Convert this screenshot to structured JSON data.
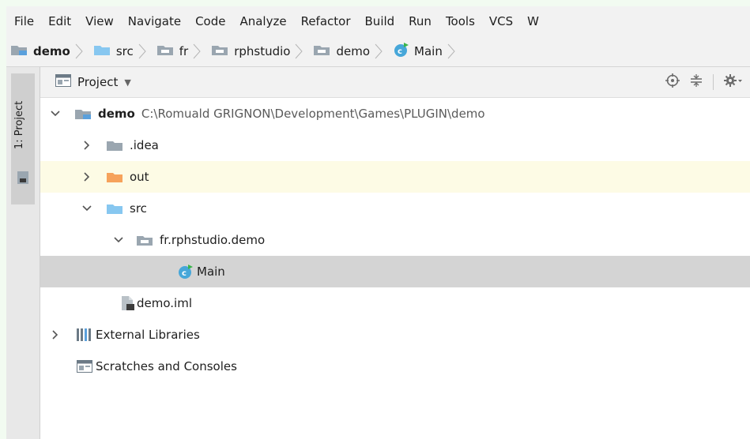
{
  "menu": [
    "File",
    "Edit",
    "View",
    "Navigate",
    "Code",
    "Analyze",
    "Refactor",
    "Build",
    "Run",
    "Tools",
    "VCS",
    "W"
  ],
  "breadcrumb": [
    {
      "label": "demo",
      "icon": "module-folder-icon",
      "bold": true
    },
    {
      "label": "src",
      "icon": "source-folder-icon"
    },
    {
      "label": "fr",
      "icon": "package-folder-icon"
    },
    {
      "label": "rphstudio",
      "icon": "package-folder-icon"
    },
    {
      "label": "demo",
      "icon": "package-folder-icon"
    },
    {
      "label": "Main",
      "icon": "class-icon"
    }
  ],
  "sidebar": {
    "tab_label": "1: Project"
  },
  "panel": {
    "title": "Project",
    "dropdown_glyph": "▼",
    "tools": [
      "locate-icon",
      "collapse-all-icon",
      "settings-gear-icon"
    ]
  },
  "tree": [
    {
      "label": "demo",
      "path": "C:\\Romuald GRIGNON\\Development\\Games\\PLUGIN\\demo",
      "icon": "module-folder",
      "expand": "open",
      "bold": true
    },
    {
      "label": ".idea",
      "icon": "folder-gray",
      "expand": "closed"
    },
    {
      "label": "out",
      "icon": "folder-orange",
      "expand": "closed",
      "highlight": true
    },
    {
      "label": "src",
      "icon": "folder-blue",
      "expand": "open"
    },
    {
      "label": "fr.rphstudio.demo",
      "icon": "package-folder",
      "expand": "open"
    },
    {
      "label": "Main",
      "icon": "class",
      "expand": "none",
      "selected": true
    },
    {
      "label": "demo.iml",
      "icon": "iml-file",
      "expand": "none"
    },
    {
      "label": "External Libraries",
      "icon": "libraries",
      "expand": "closed"
    },
    {
      "label": "Scratches and Consoles",
      "icon": "scratches",
      "expand": "none"
    }
  ],
  "colors": {
    "selection": "#d4d4d4",
    "highlight": "#fdfbe5",
    "folder_blue": "#87c7f0",
    "folder_orange": "#f6a25b",
    "class_icon": "#47a7d9"
  }
}
